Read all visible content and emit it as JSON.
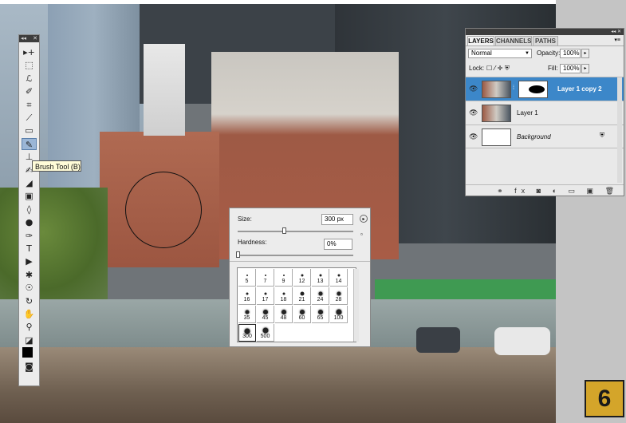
{
  "tools_panel": {
    "header_glyph_left": "◂◂",
    "header_glyph_right": "✕",
    "tooltip": "Brush Tool (B)",
    "tools": [
      {
        "name": "move-tool-icon",
        "glyph": "▸+"
      },
      {
        "name": "marquee-tool-icon",
        "glyph": "⬚"
      },
      {
        "name": "lasso-tool-icon",
        "glyph": "ℒ"
      },
      {
        "name": "quick-selection-tool-icon",
        "glyph": "✐"
      },
      {
        "name": "crop-tool-icon",
        "glyph": "⌗"
      },
      {
        "name": "eyedropper-tool-icon",
        "glyph": "⟋"
      },
      {
        "name": "spot-healing-tool-icon",
        "glyph": "▭"
      },
      {
        "name": "brush-tool-icon",
        "glyph": "✎"
      },
      {
        "name": "clone-stamp-tool-icon",
        "glyph": "⊥"
      },
      {
        "name": "history-brush-tool-icon",
        "glyph": "✍"
      },
      {
        "name": "eraser-tool-icon",
        "glyph": "◢"
      },
      {
        "name": "gradient-tool-icon",
        "glyph": "▣"
      },
      {
        "name": "blur-tool-icon",
        "glyph": "◊"
      },
      {
        "name": "dodge-tool-icon",
        "glyph": "●"
      },
      {
        "name": "pen-tool-icon",
        "glyph": "✑"
      },
      {
        "name": "type-tool-icon",
        "glyph": "T"
      },
      {
        "name": "path-selection-tool-icon",
        "glyph": "▶"
      },
      {
        "name": "shape-tool-icon",
        "glyph": "✱"
      },
      {
        "name": "3d-rotate-tool-icon",
        "glyph": "☉"
      },
      {
        "name": "3d-orbit-tool-icon",
        "glyph": "↻"
      },
      {
        "name": "hand-tool-icon",
        "glyph": "✋"
      },
      {
        "name": "zoom-tool-icon",
        "glyph": "⚲"
      },
      {
        "name": "default-colors-icon",
        "glyph": "◪"
      },
      {
        "name": "foreground-color-swatch",
        "glyph": "■"
      },
      {
        "name": "quick-mask-icon",
        "glyph": "◙"
      }
    ]
  },
  "layers_panel": {
    "header_glyph": "◂◂ ✕",
    "tabs": [
      "LAYERS",
      "CHANNELS",
      "PATHS"
    ],
    "menu_glyph": "▾≡",
    "blend_mode": "Normal",
    "opacity_label": "Opacity:",
    "opacity_value": "100%",
    "lock_label": "Lock:",
    "lock_icons": "☐ ⁄ ✛ ⛨",
    "fill_label": "Fill:",
    "fill_value": "100%",
    "layers": [
      {
        "name": "Layer 1 copy 2",
        "selected": true,
        "has_mask": true
      },
      {
        "name": "Layer 1",
        "selected": false,
        "has_mask": false
      },
      {
        "name": "Background",
        "selected": false,
        "has_mask": false,
        "locked": true
      }
    ],
    "lock_badge": "🔒",
    "footer_icons": "⚭ fx ◙ ◐ ▭ ▣ 🗑"
  },
  "brush_picker": {
    "size_label": "Size:",
    "size_value": "300 px",
    "size_fraction": 0.4,
    "hardness_label": "Hardness:",
    "hardness_value": "0%",
    "hardness_fraction": 0.0,
    "presets": [
      "5",
      "7",
      "9",
      "12",
      "13",
      "14",
      "16",
      "17",
      "18",
      "21",
      "24",
      "28",
      "35",
      "45",
      "48",
      "60",
      "65",
      "100",
      "300",
      "500"
    ],
    "selected_preset": "300"
  },
  "step_badge": "6",
  "colors": {
    "selection_blue": "#3c87c9",
    "badge_gold": "#d4a52a"
  }
}
